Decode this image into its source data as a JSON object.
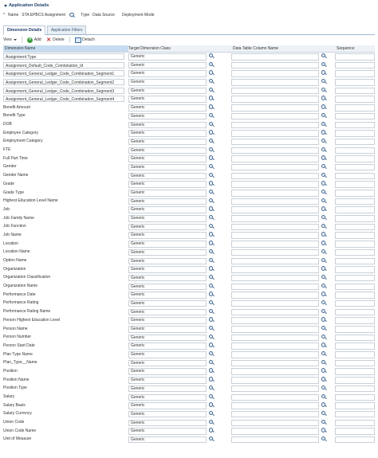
{
  "app": {
    "title": "Application Details"
  },
  "details": {
    "required_mark": "*",
    "name_label": "Name",
    "name_value": "STA EPBCS Assignment Data",
    "type_label": "Type",
    "type_value": "Data Source",
    "mode_label": "Deployment Mode"
  },
  "tabs": [
    {
      "label": "Dimension Details"
    },
    {
      "label": "Application Filters"
    }
  ],
  "toolbar": {
    "view_label": "View",
    "add_label": "Add",
    "delete_label": "Delete",
    "detach_label": "Detach"
  },
  "columns": {
    "name": "Dimension Name",
    "target": "Target Dimension Class",
    "data_col": "Data Table Column Name",
    "sequence": "Sequence"
  },
  "rows": [
    {
      "name": "Assignment Type",
      "target": "Generic"
    },
    {
      "name": "Assignment_Default_Code_Combination_Id",
      "target": "Generic"
    },
    {
      "name": "Assignment_General_Ledger_Code_Combination_Segment1",
      "target": "Generic"
    },
    {
      "name": "Assignment_General_Ledger_Code_Combination_Segment2",
      "target": "Generic"
    },
    {
      "name": "Assignment_General_Ledger_Code_Combination_Segment3",
      "target": "Generic"
    },
    {
      "name": "Assignment_General_Ledger_Code_Combination_Segment4",
      "target": "Generic"
    },
    {
      "name": "Benefit Amount",
      "target": "Generic"
    },
    {
      "name": "Benefit Type",
      "target": "Generic"
    },
    {
      "name": "DOB",
      "target": "Generic"
    },
    {
      "name": "Employee Category",
      "target": "Generic"
    },
    {
      "name": "Employment Category",
      "target": "Generic"
    },
    {
      "name": "FTE",
      "target": "Generic"
    },
    {
      "name": "Full Part Time",
      "target": "Generic"
    },
    {
      "name": "Gender",
      "target": "Generic"
    },
    {
      "name": "Gender Name",
      "target": "Generic"
    },
    {
      "name": "Grade",
      "target": "Generic"
    },
    {
      "name": "Grade Type",
      "target": "Generic"
    },
    {
      "name": "Highest Education Level Name",
      "target": "Generic"
    },
    {
      "name": "Job",
      "target": "Generic"
    },
    {
      "name": "Job Family Name",
      "target": "Generic"
    },
    {
      "name": "Job Function",
      "target": "Generic"
    },
    {
      "name": "Job Name",
      "target": "Generic"
    },
    {
      "name": "Location",
      "target": "Generic"
    },
    {
      "name": "Location Name",
      "target": "Generic"
    },
    {
      "name": "Option Name",
      "target": "Generic"
    },
    {
      "name": "Organization",
      "target": "Generic"
    },
    {
      "name": "Organization Classification",
      "target": "Generic"
    },
    {
      "name": "Organization Name",
      "target": "Generic"
    },
    {
      "name": "Performance Date",
      "target": "Generic"
    },
    {
      "name": "Performance Rating",
      "target": "Generic"
    },
    {
      "name": "Performance Rating Name",
      "target": "Generic"
    },
    {
      "name": "Person Highest Education Level",
      "target": "Generic"
    },
    {
      "name": "Person Name",
      "target": "Generic"
    },
    {
      "name": "Person Number",
      "target": "Generic"
    },
    {
      "name": "Person Start Date",
      "target": "Generic"
    },
    {
      "name": "Plan Type Name",
      "target": "Generic"
    },
    {
      "name": "Plan_Type__Name",
      "target": "Generic"
    },
    {
      "name": "Position",
      "target": "Generic"
    },
    {
      "name": "Position Name",
      "target": "Generic"
    },
    {
      "name": "Position Type",
      "target": "Generic"
    },
    {
      "name": "Salary",
      "target": "Generic"
    },
    {
      "name": "Salary Basis",
      "target": "Generic"
    },
    {
      "name": "Salary Currency",
      "target": "Generic"
    },
    {
      "name": "Union Code",
      "target": "Generic"
    },
    {
      "name": "Union Code Name",
      "target": "Generic"
    },
    {
      "name": "Unit of Measure",
      "target": "Generic"
    }
  ]
}
